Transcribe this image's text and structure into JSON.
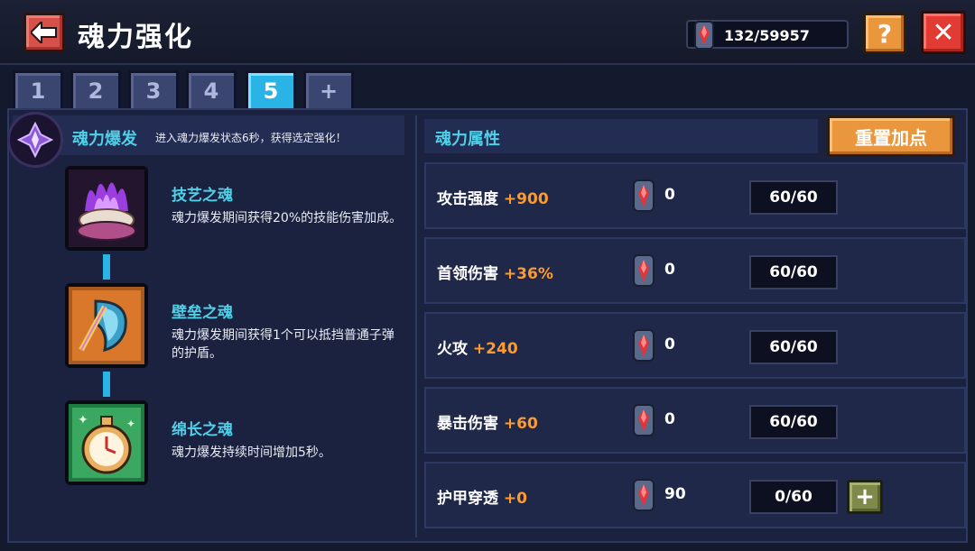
{
  "header": {
    "title": "魂力强化",
    "currency": "132/59957",
    "help_label": "?",
    "close_label": "✕"
  },
  "tabs": [
    {
      "label": "1",
      "active": false
    },
    {
      "label": "2",
      "active": false
    },
    {
      "label": "3",
      "active": false
    },
    {
      "label": "4",
      "active": false
    },
    {
      "label": "5",
      "active": true
    },
    {
      "label": "+",
      "active": false
    }
  ],
  "soul_burst": {
    "title": "魂力爆发",
    "description": "进入魂力爆发状态6秒，获得选定强化！"
  },
  "skills": [
    {
      "name": "技艺之魂",
      "desc": "魂力爆发期间获得20%的技能伤害加成。",
      "icon": "purple-flame-clam-icon"
    },
    {
      "name": "壁垒之魂",
      "desc": "魂力爆发期间获得1个可以抵挡普通子弹的护盾。",
      "icon": "shield-wing-icon"
    },
    {
      "name": "绵长之魂",
      "desc": "魂力爆发持续时间增加5秒。",
      "icon": "stopwatch-icon"
    }
  ],
  "attributes": {
    "title": "魂力属性",
    "reset_label": "重置加点",
    "rows": [
      {
        "name": "攻击强度",
        "bonus": "+900",
        "cost": "0",
        "level": "60/60",
        "can_add": false
      },
      {
        "name": "首领伤害",
        "bonus": "+36%",
        "cost": "0",
        "level": "60/60",
        "can_add": false
      },
      {
        "name": "火攻",
        "bonus": "+240",
        "cost": "0",
        "level": "60/60",
        "can_add": false
      },
      {
        "name": "暴击伤害",
        "bonus": "+60",
        "cost": "0",
        "level": "60/60",
        "can_add": false
      },
      {
        "name": "护甲穿透",
        "bonus": "+0",
        "cost": "90",
        "level": "0/60",
        "can_add": true
      }
    ],
    "plus_label": "+"
  },
  "colors": {
    "accent_cyan": "#4fd0e8",
    "bonus_orange": "#ff9a2e",
    "active_tab": "#2ab4e6"
  }
}
